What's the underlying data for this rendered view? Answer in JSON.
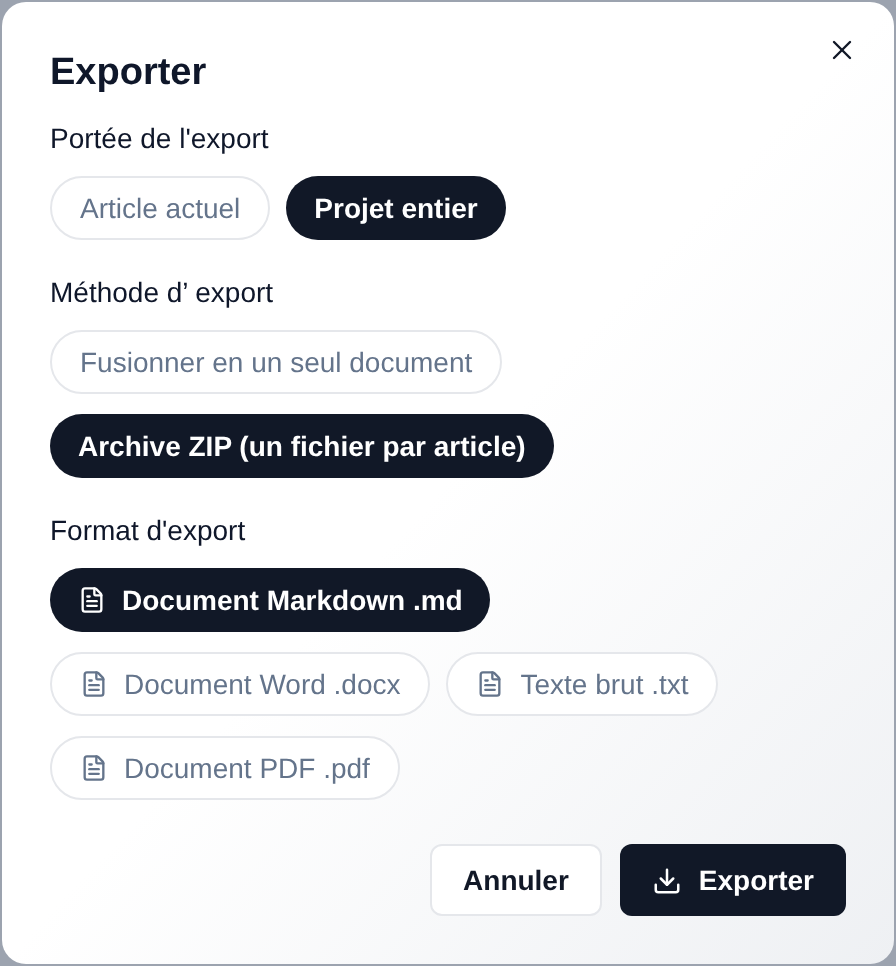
{
  "title": "Exporter",
  "sections": [
    {
      "label": "Portée de l'export",
      "kind": "plain",
      "options": [
        {
          "label": "Article actuel",
          "selected": false
        },
        {
          "label": "Projet entier",
          "selected": true
        }
      ]
    },
    {
      "label": "Méthode d’ export",
      "kind": "plain",
      "options": [
        {
          "label": "Fusionner en un seul document",
          "selected": false
        },
        {
          "label": "Archive ZIP (un fichier par article)",
          "selected": true
        }
      ]
    },
    {
      "label": "Format d'export",
      "kind": "file",
      "options": [
        {
          "label": "Document Markdown .md",
          "selected": true
        },
        {
          "label": "Document Word .docx",
          "selected": false
        },
        {
          "label": "Texte brut .txt",
          "selected": false
        },
        {
          "label": "Document PDF .pdf",
          "selected": false
        }
      ]
    }
  ],
  "buttons": [
    {
      "label": "Annuler",
      "kind": "secondary"
    },
    {
      "label": "Exporter",
      "kind": "primary"
    }
  ]
}
